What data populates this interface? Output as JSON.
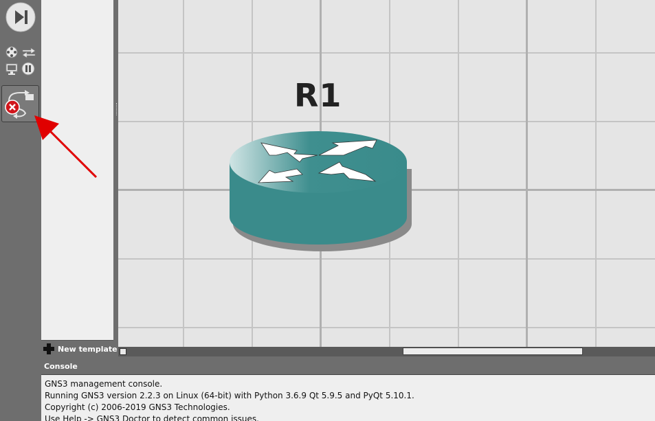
{
  "toolbar": {
    "icons": [
      "play-next-icon",
      "browse-all-devices-icon",
      "browse-switches-icon",
      "browse-end-devices-icon",
      "pause-all-icon",
      "add-link-cancel-icon"
    ]
  },
  "template_panel": {
    "new_template_label": "New template"
  },
  "topology": {
    "node_label": "R1",
    "node_type_icon": "router-icon"
  },
  "console": {
    "title": "Console",
    "lines": [
      "GNS3 management console.",
      "Running GNS3 version 2.2.3 on Linux (64-bit) with Python 3.6.9 Qt 5.9.5 and PyQt 5.10.1.",
      "Copyright (c) 2006-2019 GNS3 Technologies.",
      "Use Help -> GNS3 Doctor to detect common issues."
    ]
  },
  "colors": {
    "router_teal": "#3a8b8b",
    "annotation_arrow": "#e00000",
    "cancel_badge": "#d0161c"
  }
}
